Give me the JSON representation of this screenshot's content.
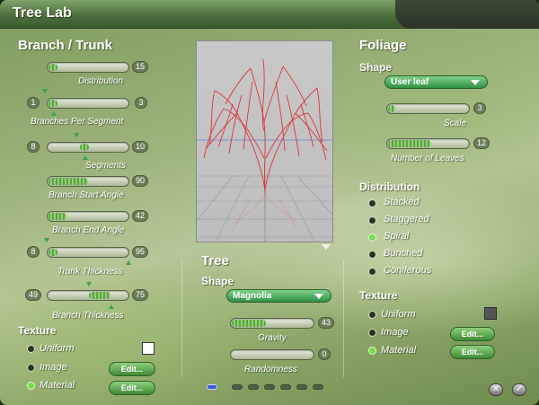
{
  "app": {
    "title": "Tree Lab"
  },
  "colors": {
    "accent_green": "#3f8a36",
    "slider_fill": "#7fc35f",
    "radio_on": "#6ee046",
    "preview_tree": "#e3232b",
    "pager_active": "#3a5bd8"
  },
  "branch": {
    "heading": "Branch / Trunk",
    "distribution": {
      "label": "Distribution",
      "value": "15"
    },
    "branches_per_segment": {
      "label": "Branches Per Segment",
      "min": "1",
      "max": "3"
    },
    "segments": {
      "label": "Segments",
      "min": "8",
      "max": "10"
    },
    "branch_start_angle": {
      "label": "Branch Start Angle",
      "value": "90"
    },
    "branch_end_angle": {
      "label": "Branch End Angle",
      "value": "42"
    },
    "trunk_thickness": {
      "label": "Trunk Thickness",
      "min": "8",
      "max": "95"
    },
    "branch_thickness": {
      "label": "Branch Thickness",
      "min": "49",
      "max": "75"
    },
    "texture": {
      "heading": "Texture",
      "uniform": "Uniform",
      "image": "Image",
      "material": "Material",
      "image_edit": "Edit...",
      "material_edit": "Edit...",
      "selected": "Material"
    }
  },
  "tree": {
    "heading": "Tree",
    "shape_label": "Shape",
    "shape_value": "Magnolia",
    "gravity": {
      "label": "Gravity",
      "value": "43"
    },
    "randomness": {
      "label": "Randomness",
      "value": "0"
    },
    "pager": {
      "count": 7,
      "active": 0
    }
  },
  "foliage": {
    "heading": "Foliage",
    "shape_label": "Shape",
    "shape_value": "User leaf",
    "scale": {
      "label": "Scale",
      "value": "3"
    },
    "number_of_leaves": {
      "label": "Number of Leaves",
      "value": "12"
    },
    "distribution": {
      "heading": "Distribution",
      "options": [
        "Stacked",
        "Staggered",
        "Spiral",
        "Bunched",
        "Coniferous"
      ],
      "selected": "Spiral"
    },
    "texture": {
      "heading": "Texture",
      "uniform": "Uniform",
      "image": "Image",
      "material": "Material",
      "image_edit": "Edit...",
      "material_edit": "Edit...",
      "selected": "Material"
    }
  },
  "footer": {
    "cancel_icon": "close-icon",
    "ok_icon": "check-icon"
  }
}
